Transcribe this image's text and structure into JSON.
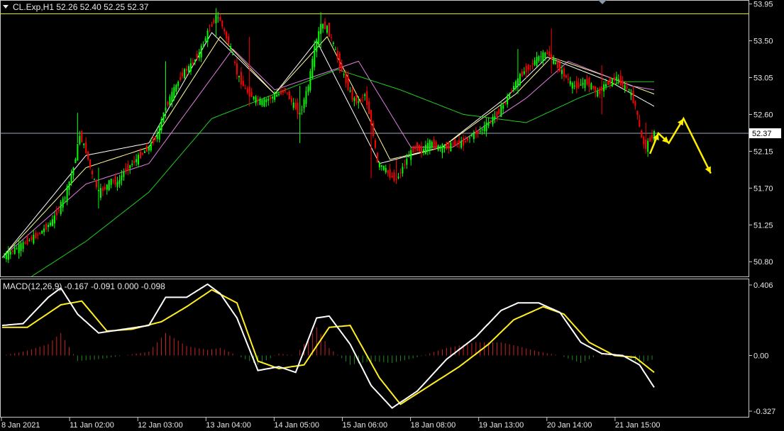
{
  "window": {
    "title": "CL.Exp,H1  52.26 52.40 52.25 52.37",
    "menu_icon": "triangle-down-icon"
  },
  "colors": {
    "background": "#000000",
    "frame": "#c8c8c8",
    "bull": "#00ff00",
    "bear": "#ff0000",
    "ma_fast": "#ffffff",
    "ma_mid": "#ffff99",
    "ma_slow": "#e07ee0",
    "ma_long": "#22cc22",
    "macd_line": "#ffffff",
    "signal_line": "#ffee22",
    "hist_pos": "#cc2222",
    "hist_neg": "#228822",
    "forecast": "#ffee00",
    "price_line": "#9aa7b8",
    "top_line": "#e6e600"
  },
  "chart_data": [
    {
      "type": "candlestick",
      "symbol": "CL.Exp",
      "timeframe": "H1",
      "ohlc_header": {
        "open": 52.26,
        "high": 52.4,
        "low": 52.25,
        "close": 52.37
      },
      "y_ticks": [
        "53.95",
        "53.50",
        "53.05",
        "52.60",
        "52.15",
        "51.70",
        "51.25",
        "50.80"
      ],
      "ylim": [
        50.62,
        53.99
      ],
      "current_price_label": "52.37",
      "current_price": 52.37,
      "top_line_price": 53.83,
      "x_ticks": [
        "8 Jan 2021",
        "11 Jan 02:00",
        "12 Jan 03:00",
        "13 Jan 04:00",
        "14 Jan 05:00",
        "15 Jan 06:00",
        "18 Jan 08:00",
        "19 Jan 13:00",
        "20 Jan 14:00",
        "21 Jan 15:00"
      ],
      "price_path": [
        [
          0,
          50.85
        ],
        [
          6,
          50.95
        ],
        [
          12,
          51.05
        ],
        [
          18,
          51.15
        ],
        [
          24,
          51.3
        ],
        [
          30,
          51.6
        ],
        [
          34,
          51.95
        ],
        [
          37,
          52.35
        ],
        [
          40,
          52.15
        ],
        [
          43,
          51.85
        ],
        [
          46,
          51.65
        ],
        [
          49,
          51.7
        ],
        [
          52,
          51.8
        ],
        [
          55,
          51.75
        ],
        [
          58,
          51.9
        ],
        [
          62,
          52.0
        ],
        [
          66,
          52.1
        ],
        [
          70,
          52.2
        ],
        [
          74,
          52.35
        ],
        [
          78,
          52.7
        ],
        [
          82,
          52.9
        ],
        [
          86,
          53.1
        ],
        [
          90,
          53.2
        ],
        [
          94,
          53.35
        ],
        [
          98,
          53.6
        ],
        [
          102,
          53.8
        ],
        [
          104,
          53.75
        ],
        [
          106,
          53.6
        ],
        [
          109,
          53.4
        ],
        [
          112,
          53.1
        ],
        [
          116,
          52.9
        ],
        [
          120,
          52.8
        ],
        [
          124,
          52.75
        ],
        [
          128,
          52.8
        ],
        [
          132,
          52.85
        ],
        [
          135,
          52.9
        ],
        [
          138,
          52.75
        ],
        [
          142,
          52.6
        ],
        [
          146,
          52.95
        ],
        [
          149,
          53.4
        ],
        [
          152,
          53.7
        ],
        [
          155,
          53.65
        ],
        [
          158,
          53.45
        ],
        [
          161,
          53.2
        ],
        [
          164,
          53.0
        ],
        [
          167,
          52.8
        ],
        [
          170,
          52.75
        ],
        [
          173,
          52.85
        ],
        [
          176,
          52.5
        ],
        [
          179,
          52.0
        ],
        [
          182,
          51.95
        ],
        [
          185,
          51.85
        ],
        [
          188,
          51.8
        ],
        [
          191,
          51.95
        ],
        [
          194,
          52.1
        ],
        [
          197,
          52.2
        ],
        [
          200,
          52.15
        ],
        [
          204,
          52.25
        ],
        [
          208,
          52.2
        ],
        [
          212,
          52.2
        ],
        [
          216,
          52.25
        ],
        [
          220,
          52.25
        ],
        [
          224,
          52.35
        ],
        [
          228,
          52.4
        ],
        [
          232,
          52.5
        ],
        [
          236,
          52.6
        ],
        [
          240,
          52.75
        ],
        [
          244,
          52.95
        ],
        [
          248,
          53.1
        ],
        [
          252,
          53.2
        ],
        [
          256,
          53.3
        ],
        [
          260,
          53.35
        ],
        [
          263,
          53.25
        ],
        [
          266,
          53.15
        ],
        [
          269,
          53.05
        ],
        [
          272,
          52.95
        ],
        [
          275,
          52.95
        ],
        [
          278,
          53.0
        ],
        [
          281,
          52.95
        ],
        [
          284,
          52.85
        ],
        [
          287,
          52.95
        ],
        [
          290,
          53.0
        ],
        [
          293,
          53.05
        ],
        [
          296,
          52.95
        ],
        [
          299,
          52.9
        ],
        [
          302,
          52.7
        ],
        [
          305,
          52.3
        ],
        [
          307,
          52.2
        ],
        [
          309,
          52.3
        ],
        [
          311,
          52.37
        ]
      ],
      "wicks": [
        [
          36,
          52.25,
          52.62
        ],
        [
          46,
          51.45,
          51.95
        ],
        [
          78,
          52.55,
          53.25
        ],
        [
          102,
          53.55,
          53.9
        ],
        [
          118,
          52.7,
          53.55
        ],
        [
          142,
          52.25,
          52.95
        ],
        [
          152,
          53.4,
          53.85
        ],
        [
          176,
          51.82,
          52.65
        ],
        [
          188,
          51.75,
          52.05
        ],
        [
          246,
          52.85,
          53.4
        ],
        [
          262,
          53.1,
          53.65
        ],
        [
          286,
          52.6,
          53.2
        ],
        [
          307,
          52.12,
          52.5
        ]
      ],
      "moving_averages": [
        {
          "name": "fast",
          "values": [
            [
              0,
              50.85
            ],
            [
              40,
              52.1
            ],
            [
              70,
              52.25
            ],
            [
              100,
              53.6
            ],
            [
              130,
              52.85
            ],
            [
              150,
              53.5
            ],
            [
              180,
              52.0
            ],
            [
              210,
              52.2
            ],
            [
              240,
              52.8
            ],
            [
              260,
              53.3
            ],
            [
              290,
              53.0
            ],
            [
              311,
              52.7
            ]
          ]
        },
        {
          "name": "mid",
          "values": [
            [
              0,
              50.85
            ],
            [
              40,
              51.95
            ],
            [
              70,
              52.2
            ],
            [
              104,
              53.55
            ],
            [
              130,
              52.85
            ],
            [
              155,
              53.55
            ],
            [
              185,
              52.05
            ],
            [
              210,
              52.2
            ],
            [
              245,
              52.85
            ],
            [
              262,
              53.3
            ],
            [
              290,
              53.05
            ],
            [
              311,
              52.85
            ]
          ]
        },
        {
          "name": "slow",
          "values": [
            [
              0,
              50.85
            ],
            [
              40,
              51.75
            ],
            [
              70,
              52.0
            ],
            [
              110,
              53.4
            ],
            [
              130,
              52.9
            ],
            [
              170,
              53.25
            ],
            [
              195,
              52.2
            ],
            [
              215,
              52.2
            ],
            [
              250,
              52.8
            ],
            [
              270,
              53.25
            ],
            [
              300,
              52.95
            ],
            [
              311,
              52.9
            ]
          ]
        },
        {
          "name": "long",
          "values": [
            [
              14,
              50.62
            ],
            [
              40,
              51.05
            ],
            [
              70,
              51.65
            ],
            [
              100,
              52.55
            ],
            [
              130,
              52.85
            ],
            [
              160,
              53.15
            ],
            [
              190,
              52.9
            ],
            [
              220,
              52.6
            ],
            [
              250,
              52.5
            ],
            [
              275,
              52.8
            ],
            [
              295,
              53.0
            ],
            [
              311,
              53.0
            ]
          ]
        }
      ],
      "forecast_path": [
        [
          309,
          52.12
        ],
        [
          313,
          52.37
        ],
        [
          318,
          52.25
        ],
        [
          325,
          52.55
        ],
        [
          338,
          51.88
        ]
      ]
    },
    {
      "type": "line",
      "title": "MACD(12,26,9) -0.167 -0.091 0.000 -0.098",
      "y_ticks": [
        "0.406",
        "0.00",
        "-0.327"
      ],
      "ylim": [
        -0.327,
        0.406
      ],
      "macd_line": [
        [
          0,
          0.16
        ],
        [
          10,
          0.17
        ],
        [
          22,
          0.31
        ],
        [
          28,
          0.36
        ],
        [
          36,
          0.22
        ],
        [
          46,
          0.12
        ],
        [
          58,
          0.14
        ],
        [
          70,
          0.16
        ],
        [
          78,
          0.31
        ],
        [
          88,
          0.31
        ],
        [
          98,
          0.38
        ],
        [
          104,
          0.33
        ],
        [
          112,
          0.2
        ],
        [
          122,
          -0.08
        ],
        [
          132,
          -0.06
        ],
        [
          140,
          -0.09
        ],
        [
          150,
          0.2
        ],
        [
          156,
          0.21
        ],
        [
          166,
          0.06
        ],
        [
          176,
          -0.16
        ],
        [
          186,
          -0.28
        ],
        [
          198,
          -0.19
        ],
        [
          212,
          -0.02
        ],
        [
          226,
          0.1
        ],
        [
          238,
          0.24
        ],
        [
          246,
          0.28
        ],
        [
          256,
          0.28
        ],
        [
          266,
          0.23
        ],
        [
          276,
          0.07
        ],
        [
          286,
          0.01
        ],
        [
          296,
          0.0
        ],
        [
          304,
          -0.05
        ],
        [
          311,
          -0.17
        ]
      ],
      "signal_line": [
        [
          0,
          0.15
        ],
        [
          12,
          0.15
        ],
        [
          28,
          0.27
        ],
        [
          38,
          0.29
        ],
        [
          50,
          0.13
        ],
        [
          62,
          0.14
        ],
        [
          76,
          0.18
        ],
        [
          88,
          0.26
        ],
        [
          100,
          0.35
        ],
        [
          112,
          0.28
        ],
        [
          122,
          -0.03
        ],
        [
          132,
          -0.07
        ],
        [
          144,
          -0.05
        ],
        [
          156,
          0.15
        ],
        [
          166,
          0.16
        ],
        [
          180,
          -0.12
        ],
        [
          190,
          -0.26
        ],
        [
          204,
          -0.16
        ],
        [
          218,
          -0.06
        ],
        [
          232,
          0.06
        ],
        [
          244,
          0.19
        ],
        [
          258,
          0.26
        ],
        [
          268,
          0.22
        ],
        [
          280,
          0.07
        ],
        [
          292,
          0.0
        ],
        [
          302,
          -0.01
        ],
        [
          311,
          -0.09
        ]
      ],
      "histogram_path": [
        [
          0,
          0.0
        ],
        [
          10,
          0.02
        ],
        [
          22,
          0.06
        ],
        [
          28,
          0.12
        ],
        [
          36,
          -0.03
        ],
        [
          46,
          -0.02
        ],
        [
          58,
          0.0
        ],
        [
          70,
          0.02
        ],
        [
          78,
          0.12
        ],
        [
          88,
          0.05
        ],
        [
          98,
          0.03
        ],
        [
          104,
          0.04
        ],
        [
          112,
          0.0
        ],
        [
          122,
          -0.05
        ],
        [
          132,
          0.01
        ],
        [
          140,
          0.0
        ],
        [
          150,
          0.15
        ],
        [
          156,
          0.04
        ],
        [
          166,
          -0.05
        ],
        [
          176,
          -0.03
        ],
        [
          186,
          -0.04
        ],
        [
          198,
          -0.01
        ],
        [
          212,
          0.04
        ],
        [
          226,
          0.07
        ],
        [
          238,
          0.07
        ],
        [
          246,
          0.05
        ],
        [
          256,
          0.02
        ],
        [
          266,
          0.0
        ],
        [
          276,
          -0.04
        ],
        [
          286,
          0.01
        ],
        [
          296,
          0.0
        ],
        [
          304,
          -0.04
        ],
        [
          311,
          -0.02
        ]
      ]
    }
  ]
}
